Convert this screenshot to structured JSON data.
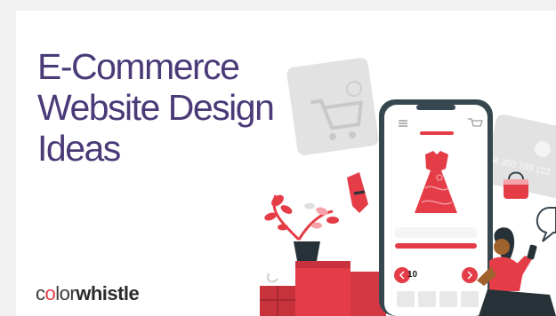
{
  "headline": {
    "line1": "E-Commerce",
    "line2": "Website Design",
    "line3": "Ideas"
  },
  "brand": {
    "part1": "c",
    "part2": "o",
    "part3": "lor",
    "part4": "whistle"
  },
  "illustration": {
    "price_label": "10",
    "card_number": "56 300 789 123",
    "icons": [
      "menu-icon",
      "cart-icon",
      "dress-icon",
      "back-arrow-icon",
      "forward-arrow-icon",
      "handbag-icon",
      "chat-bubble-icon",
      "credit-card-icon",
      "shopping-cart-icon"
    ]
  },
  "colors": {
    "title": "#4a3b78",
    "accent": "#e53d48",
    "phone": "#37474f"
  }
}
